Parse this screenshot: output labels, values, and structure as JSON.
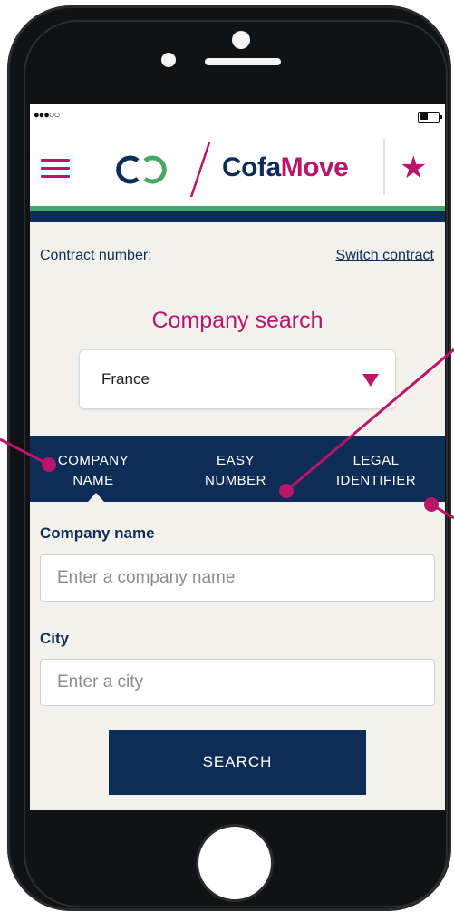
{
  "status_bar": {
    "signal": "●●●○○",
    "icons": [
      "signal-dots-icon",
      "battery-icon"
    ]
  },
  "header": {
    "brand_part_1": "Cofa",
    "brand_part_2": "Move",
    "icons": [
      "hamburger-menu-icon",
      "cofamove-logo-icon",
      "star-icon"
    ]
  },
  "contract": {
    "label": "Contract number:",
    "switch_link": "Switch contract"
  },
  "search": {
    "title": "Company search",
    "country_select": {
      "value": "France",
      "icon": "dropdown-triangle-icon"
    },
    "tabs": [
      {
        "line1": "COMPANY",
        "line2": "NAME",
        "active": true
      },
      {
        "line1": "EASY",
        "line2": "NUMBER",
        "active": false
      },
      {
        "line1": "LEGAL",
        "line2": "IDENTIFIER",
        "active": false
      }
    ],
    "fields": {
      "company_label": "Company name",
      "company_placeholder": "Enter a company name",
      "city_label": "City",
      "city_placeholder": "Enter a city"
    },
    "button_label": "SEARCH"
  },
  "colors": {
    "brand_magenta": "#b9156b",
    "brand_navy": "#0d2d57",
    "accent_green": "#4aa866",
    "screen_background": "#f2f1ec"
  }
}
